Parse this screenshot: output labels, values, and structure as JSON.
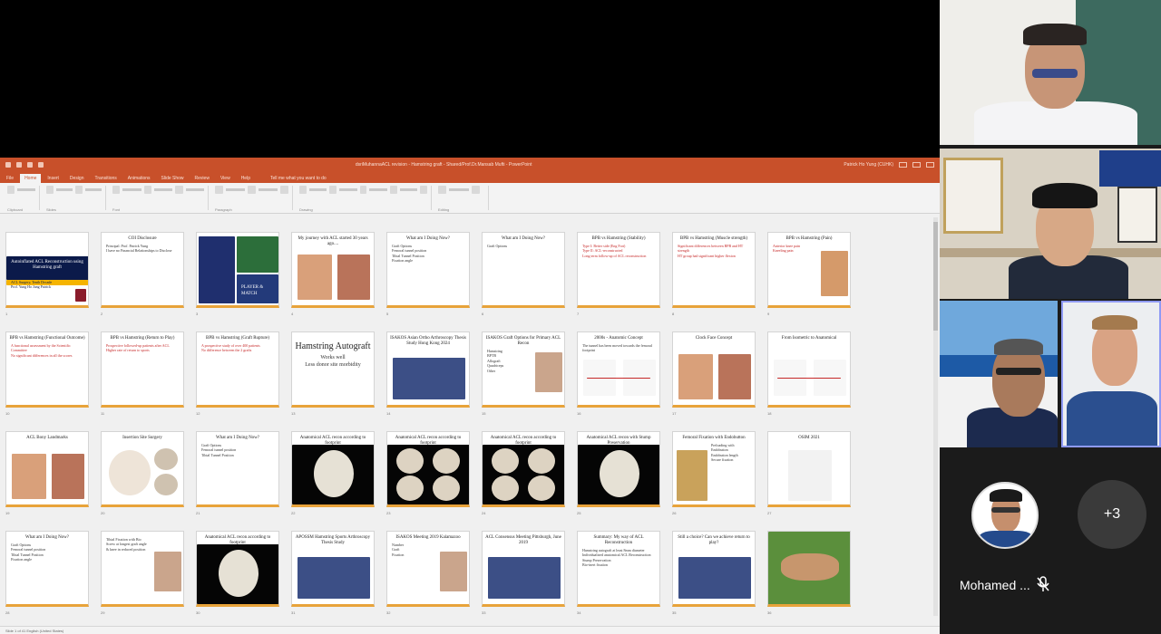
{
  "ppt": {
    "window_title": "dsriMuhannaACL revision - Hamstring graft - Shared/Prof.Dr.Mansab Mufti - PowerPoint",
    "user": "Patrick Ho Yung (CUHK)",
    "tabs": [
      "File",
      "Home",
      "Insert",
      "Design",
      "Transitions",
      "Animations",
      "Slide Show",
      "Review",
      "View",
      "Help"
    ],
    "tell_me": "Tell me what you want to do",
    "ribbon_groups": [
      "Clipboard",
      "Slides",
      "Font",
      "Paragraph",
      "Drawing",
      "Editing"
    ],
    "status": "Slide 1 of 41   English (United States)",
    "accent_color": "#c8502a"
  },
  "slides": [
    {
      "n": "1",
      "title": "Autoinflated ACL Reconstruction using Hamstring graft",
      "lines": [
        "ACL Surgery, Tenth Decade",
        "Prof. Yung Ho Jung Patrick"
      ],
      "red": false,
      "kind": "cover"
    },
    {
      "n": "2",
      "title": "COI Disclosure",
      "lines": [
        "Principal: Prof. Patrick Yung",
        "I have no Financial Relationships to Disclose"
      ],
      "red": false,
      "kind": "text"
    },
    {
      "n": "3",
      "title": "",
      "lines": [
        "PLAYER & MATCH"
      ],
      "red": false,
      "kind": "photo"
    },
    {
      "n": "4",
      "title": "My journey with ACL started 30 years ago....",
      "lines": [],
      "red": false,
      "kind": "photo2"
    },
    {
      "n": "5",
      "title": "What am I Doing Now?",
      "lines": [
        "Graft Options",
        "Femoral tunnel position",
        "Tibial Tunnel Position",
        "Fixation angle"
      ],
      "red": false,
      "kind": "text"
    },
    {
      "n": "6",
      "title": "What am I Doing Now?",
      "lines": [
        "Graft Options"
      ],
      "red": false,
      "kind": "text"
    },
    {
      "n": "7",
      "title": "BPB vs Hamstring (Stability)",
      "lines": [
        "Type I: Better side (Eng Fort)",
        "Type II: ACL-reconstructed",
        "Long term follow-up of ACL reconstruction"
      ],
      "red": true,
      "kind": "text"
    },
    {
      "n": "8",
      "title": "BPB vs Hamstring (Muscle strength)",
      "lines": [
        "Significant differences between BPB and HT strength",
        "HT group had significant higher flexion"
      ],
      "red": true,
      "kind": "text"
    },
    {
      "n": "9",
      "title": "BPB vs Hamstring (Pain)",
      "lines": [
        "Anterior knee pain",
        "Kneeling pain"
      ],
      "red": true,
      "kind": "photo-side"
    },
    {
      "n": "10",
      "title": "BPB vs Hamstring (Functional Outcome)",
      "lines": [
        "A functional assessment by the Scientific Committee",
        "No significant differences in all the scores"
      ],
      "red": true,
      "kind": "text"
    },
    {
      "n": "11",
      "title": "BPB vs Hamstring (Return to Play)",
      "lines": [
        "Prospective followed-up patients after ACL",
        "Higher rate of return to sports"
      ],
      "red": true,
      "kind": "text"
    },
    {
      "n": "12",
      "title": "BPB vs Hamstring (Graft Rupture)",
      "lines": [
        "A prospective study of over 400 patients",
        "No difference between the 2 grafts"
      ],
      "red": true,
      "kind": "text"
    },
    {
      "n": "13",
      "title": "Hamstring Autograft",
      "lines": [
        "Works well",
        "Less donor site morbidity"
      ],
      "red": false,
      "kind": "big"
    },
    {
      "n": "14",
      "title": "ISAKOS Asian Ortho Arthroscopy Thesis Study Hong Kong 2024",
      "lines": [],
      "red": false,
      "kind": "group"
    },
    {
      "n": "15",
      "title": "ISAKOS Graft Options for Primary ACL Recon",
      "lines": [
        "Hamstring",
        "BPTB",
        "Allograft",
        "Quadriceps",
        "Other"
      ],
      "red": false,
      "kind": "text-img"
    },
    {
      "n": "16",
      "title": "2000s - Anatomic Concept",
      "lines": [
        "The tunnel has been moved towards the femoral footprint"
      ],
      "red": false,
      "kind": "diagram"
    },
    {
      "n": "17",
      "title": "Clock Face Concept",
      "lines": [],
      "red": false,
      "kind": "photo2"
    },
    {
      "n": "18",
      "title": "From Isometric  to Anatomical",
      "lines": [],
      "red": false,
      "kind": "diagram"
    },
    {
      "n": "19",
      "title": "ACL Bony Landmarks",
      "lines": [],
      "red": false,
      "kind": "photo2"
    },
    {
      "n": "20",
      "title": "Insertion Site Surgery",
      "lines": [],
      "red": false,
      "kind": "scope"
    },
    {
      "n": "21",
      "title": "What am I Doing Now?",
      "lines": [
        "Graft Options",
        "Femoral tunnel position",
        "Tibial Tunnel Position"
      ],
      "red": false,
      "kind": "text"
    },
    {
      "n": "22",
      "title": "Anatomical ACL recon according to footprint",
      "lines": [],
      "red": false,
      "kind": "black1"
    },
    {
      "n": "23",
      "title": "Anatomical ACL recon according to footprint",
      "lines": [],
      "red": false,
      "kind": "black4"
    },
    {
      "n": "24",
      "title": "Anatomical ACL recon according to footprint",
      "lines": [],
      "red": false,
      "kind": "black4"
    },
    {
      "n": "25",
      "title": "Anatomical ACL recon with Stump Preservation",
      "lines": [],
      "red": false,
      "kind": "black1"
    },
    {
      "n": "26",
      "title": "Femoral Fixation with Endobutton",
      "lines": [
        "Preloading with Endobutton",
        "Endobutton length",
        "Secure fixation"
      ],
      "red": false,
      "kind": "photo-left"
    },
    {
      "n": "27",
      "title": "OSIM 2021",
      "lines": [],
      "red": false,
      "kind": "doc"
    },
    {
      "n": "28",
      "title": "What am I Doing Now?",
      "lines": [
        "Graft Options",
        "Femoral tunnel position",
        "Tibial Tunnel Position",
        "Fixation angle"
      ],
      "red": false,
      "kind": "text"
    },
    {
      "n": "29",
      "title": "",
      "lines": [
        "Tibial Fixation with Bio Screw at longest graft angle & knee in reduced position"
      ],
      "red": false,
      "kind": "text-img"
    },
    {
      "n": "30",
      "title": "Anatomical ACL recon according to footprint",
      "lines": [],
      "red": false,
      "kind": "black1"
    },
    {
      "n": "31",
      "title": "APOSSM Hamstring Sports Arthroscopy Thesis Study",
      "lines": [],
      "red": false,
      "kind": "group"
    },
    {
      "n": "32",
      "title": "ISAKOS Meeting 2019 Kalamazoo",
      "lines": [
        "Number",
        "Graft",
        "Fixation"
      ],
      "red": false,
      "kind": "text-img"
    },
    {
      "n": "33",
      "title": "ACL Consensus Meeting Pittsburgh, June 2019",
      "lines": [],
      "red": false,
      "kind": "group"
    },
    {
      "n": "34",
      "title": "Summary: My way of ACL Reconstruction",
      "lines": [
        "Hamstring autograft at least 8mm diameter",
        "Individualized anatomical ACL Reconstruction",
        "Stump Preservation",
        "Bio-inert fixation"
      ],
      "red": false,
      "kind": "text"
    },
    {
      "n": "35",
      "title": "Still a choice? Can we achieve return to play?",
      "lines": [],
      "red": false,
      "kind": "group"
    },
    {
      "n": "36",
      "title": "",
      "lines": [],
      "red": false,
      "kind": "hands"
    }
  ],
  "participants": {
    "name_label": "Mohamed ...",
    "more_count": "+3",
    "mic_icon": "mic-muted-icon",
    "speaking_color": "#8f9af5"
  }
}
